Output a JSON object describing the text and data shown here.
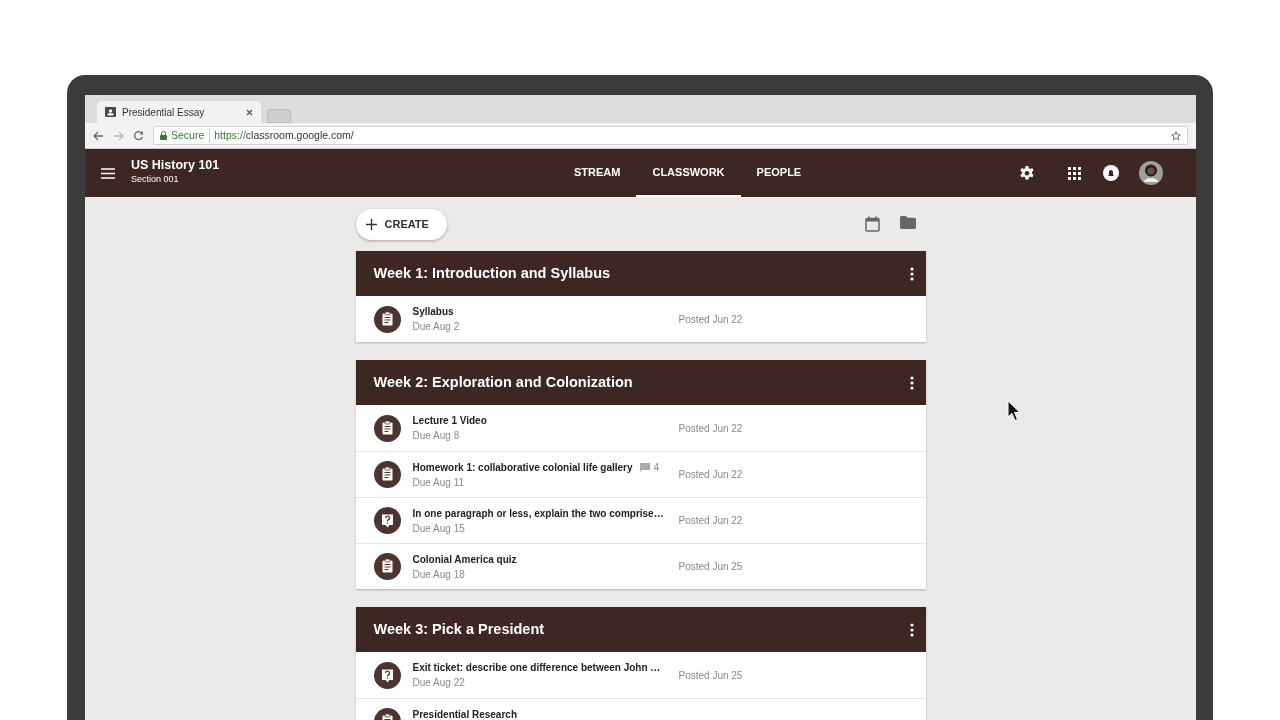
{
  "browser": {
    "tab_title": "Presidential Essay",
    "secure_label": "Secure",
    "url_scheme": "https://",
    "url_host": "classroom.google.com/"
  },
  "app_bar": {
    "class_name": "US History 101",
    "section": "Section 001"
  },
  "tabs": [
    {
      "label": "STREAM",
      "selected": false
    },
    {
      "label": "CLASSWORK",
      "selected": true
    },
    {
      "label": "PEOPLE",
      "selected": false
    }
  ],
  "create_button": "CREATE",
  "topics": [
    {
      "title": "Week 1: Introduction and Syllabus",
      "items": [
        {
          "kind": "assignment",
          "title": "Syllabus",
          "due": "Due Aug 2",
          "posted": "Posted Jun 22"
        }
      ]
    },
    {
      "title": "Week 2: Exploration and Colonization",
      "items": [
        {
          "kind": "assignment",
          "title": "Lecture 1 Video",
          "due": "Due Aug 8",
          "posted": "Posted Jun 22"
        },
        {
          "kind": "assignment",
          "title": "Homework 1: collaborative colonial life gallery",
          "comments": "4",
          "due": "Due Aug 11",
          "posted": "Posted Jun 22"
        },
        {
          "kind": "question",
          "title": "In one paragraph or less, explain the two comprise…",
          "due": "Due Aug 15",
          "posted": "Posted Jun 22"
        },
        {
          "kind": "assignment",
          "title": "Colonial America quiz",
          "due": "Due Aug 18",
          "posted": "Posted Jun 25"
        }
      ]
    },
    {
      "title": "Week 3: Pick a President",
      "items": [
        {
          "kind": "question",
          "title": "Exit ticket: describe one difference between John …",
          "due": "Due Aug 22",
          "posted": "Posted Jun 25"
        },
        {
          "kind": "assignment",
          "title": "Presidential Research"
        }
      ]
    }
  ]
}
